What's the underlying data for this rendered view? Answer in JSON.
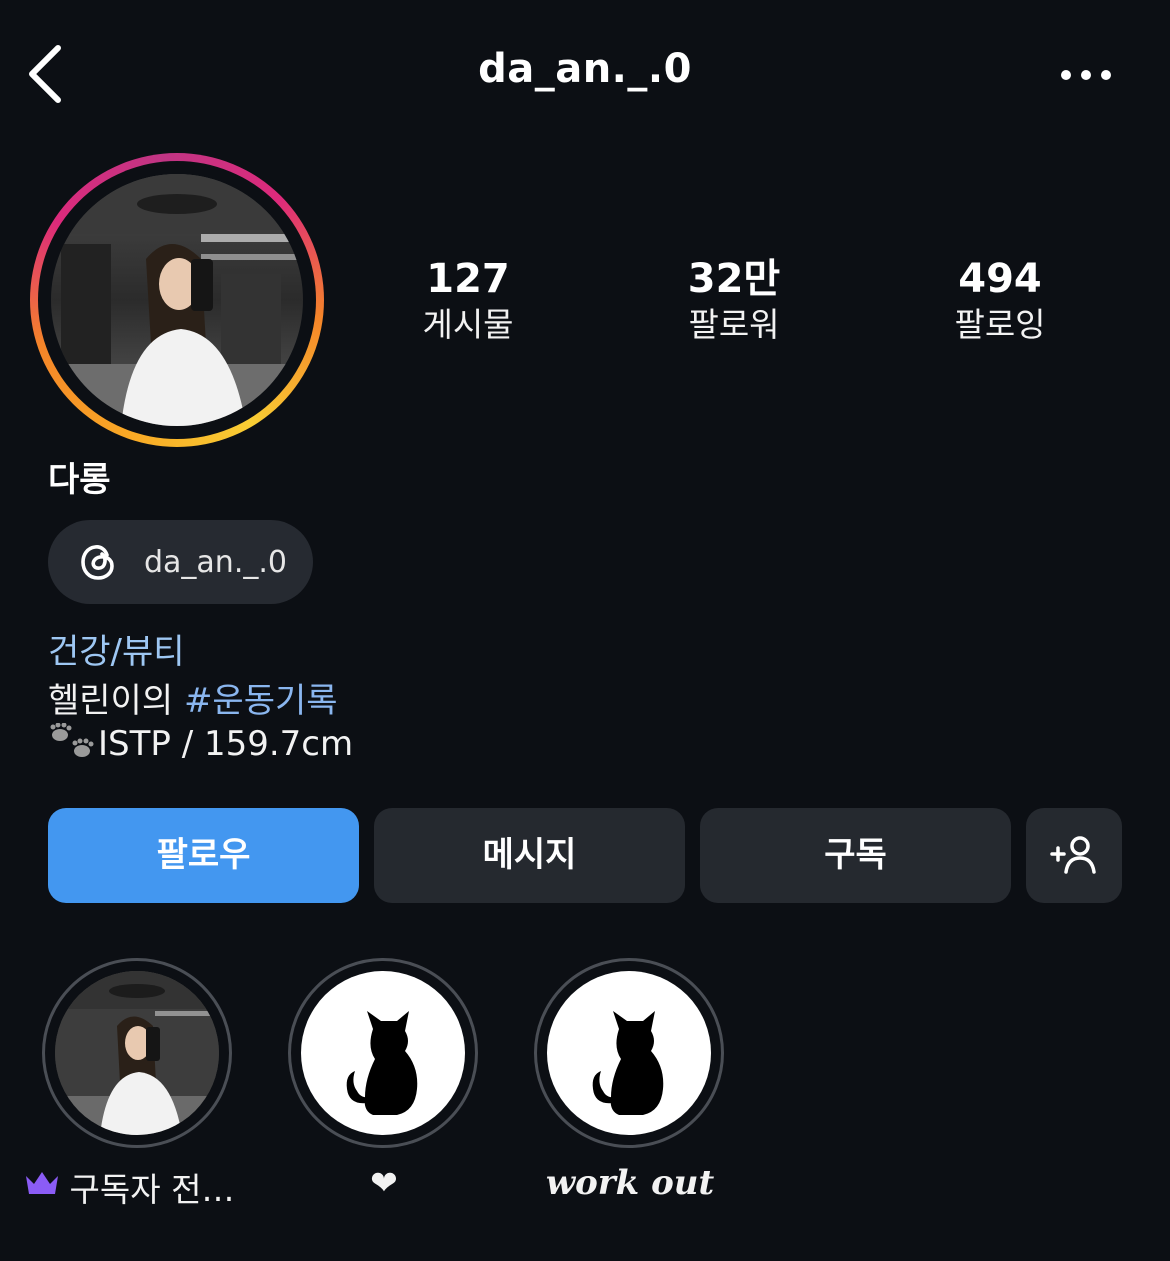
{
  "header": {
    "username": "da_an._.0"
  },
  "profile": {
    "display_name": "다롱",
    "stats": [
      {
        "value": "127",
        "label": "게시물"
      },
      {
        "value": "32만",
        "label": "팔로워"
      },
      {
        "value": "494",
        "label": "팔로잉"
      }
    ],
    "threads_handle": "da_an._.0",
    "bio": {
      "category": "건강/뷰티",
      "line1_text": "헬린이의 ",
      "line1_hashtag": "#운동기록",
      "line2_text": "ISTP / 159.7cm"
    }
  },
  "actions": {
    "follow_label": "팔로우",
    "message_label": "메시지",
    "subscribe_label": "구독"
  },
  "highlights": [
    {
      "label": "구독자 전…",
      "icon": "crown-icon"
    },
    {
      "label": "❤",
      "icon": "cat-silhouette"
    },
    {
      "label": "work out",
      "icon": "cat-silhouette"
    }
  ],
  "colors": {
    "background": "#0c0f14",
    "follow_button": "#4397f0",
    "secondary_button": "#25292f",
    "category_link": "#9ec7f3",
    "hashtag": "#8ab6ef",
    "crown": "#8b5cf6"
  }
}
